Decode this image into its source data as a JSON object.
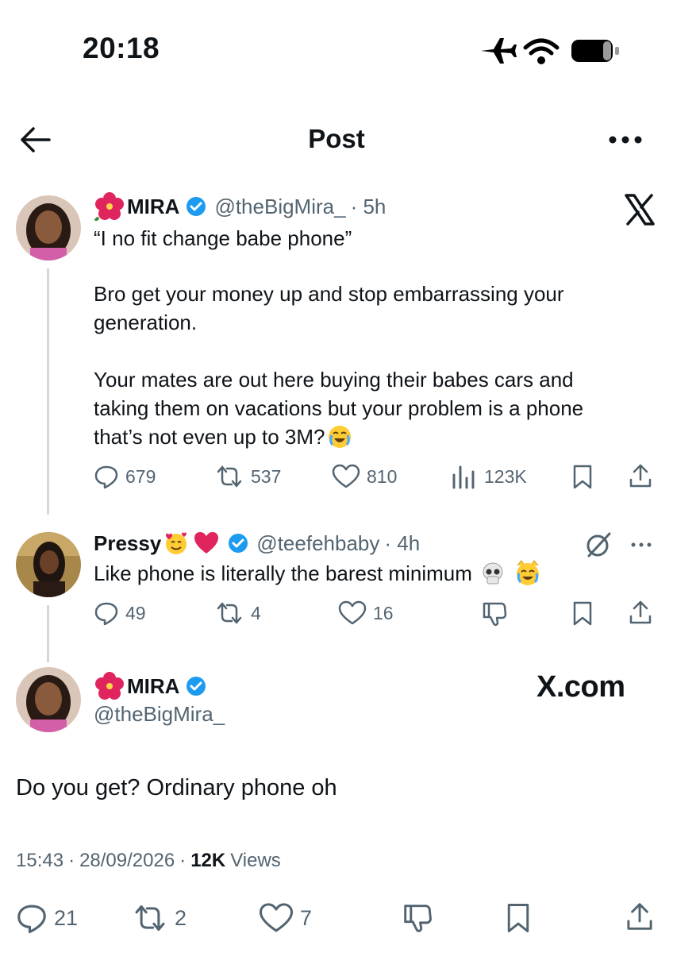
{
  "status_bar": {
    "time": "20:18"
  },
  "header": {
    "title": "Post"
  },
  "quoted_tweet": {
    "name": "MIRA",
    "handle": "@theBigMira_",
    "time": "· 5h",
    "text_line1": "“I no fit change babe phone”",
    "para2_line1": "Bro get your money up and stop embarrassing your",
    "para2_line2": "generation.",
    "para3_line1": "Your mates are out here buying their babes cars and",
    "para3_line2": "taking them on vacations but your problem is a phone",
    "para3_line3": "that’s not even up to 3M?",
    "replies": "679",
    "reposts": "537",
    "likes": "810",
    "views": "123K"
  },
  "reply_tweet": {
    "name": "Pressy",
    "handle": "@teefehbaby",
    "time": "· 4h",
    "text": "Like phone is literally the barest minimum",
    "replies": "49",
    "reposts": "4",
    "likes": "16"
  },
  "main_tweet": {
    "name": "MIRA",
    "handle": "@theBigMira_",
    "watermark": "X.com",
    "text": "Do you get? Ordinary phone oh",
    "time": "15:43",
    "date": "28/09/2026",
    "views_count": "12K",
    "views_label": "Views",
    "replies": "21",
    "reposts": "2",
    "likes": "7"
  },
  "colors": {
    "verified": "#1d9bf0",
    "muted": "#536471",
    "text": "#0f1419"
  }
}
